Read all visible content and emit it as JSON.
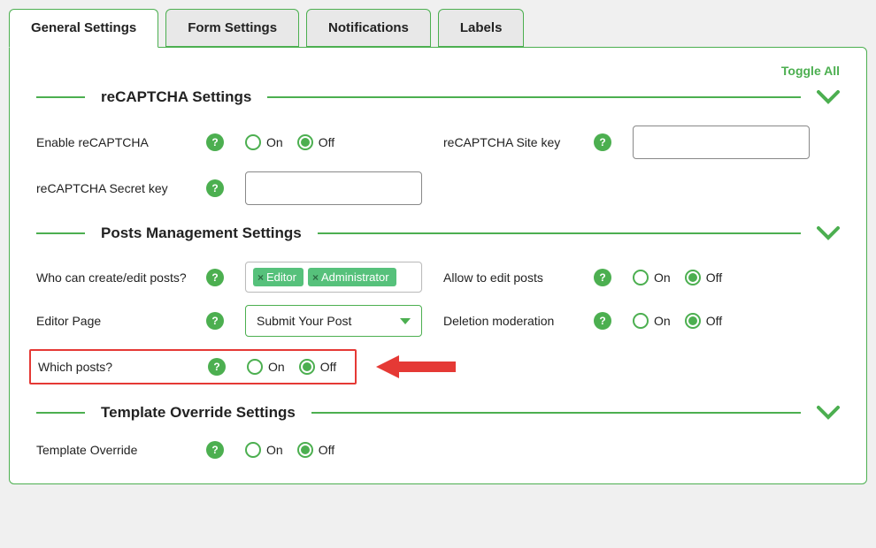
{
  "tabs": {
    "general": "General Settings",
    "form": "Form Settings",
    "notifications": "Notifications",
    "labels": "Labels"
  },
  "toggle_all": "Toggle All",
  "radio": {
    "on": "On",
    "off": "Off"
  },
  "sections": {
    "recaptcha": {
      "title": "reCAPTCHA Settings",
      "enable_label": "Enable reCAPTCHA",
      "site_key_label": "reCAPTCHA Site key",
      "secret_key_label": "reCAPTCHA Secret key"
    },
    "posts": {
      "title": "Posts Management Settings",
      "who_label": "Who can create/edit posts?",
      "roles": [
        "Editor",
        "Administrator"
      ],
      "allow_edit_label": "Allow to edit posts",
      "editor_page_label": "Editor Page",
      "editor_page_value": "Submit Your Post",
      "deletion_label": "Deletion moderation",
      "which_posts_label": "Which posts?"
    },
    "template": {
      "title": "Template Override Settings",
      "override_label": "Template Override"
    }
  }
}
